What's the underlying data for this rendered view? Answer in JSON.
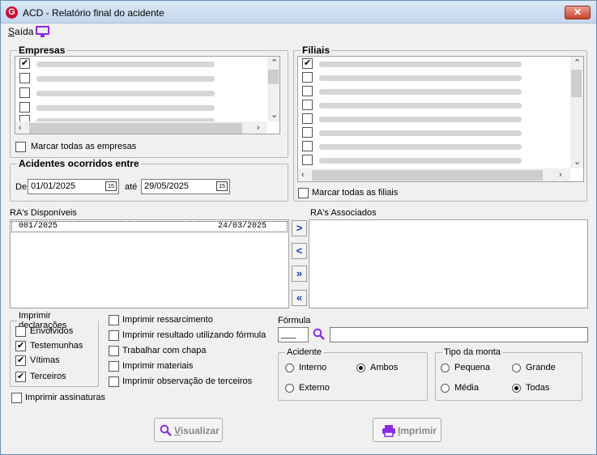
{
  "window": {
    "title": "ACD - Relatório final do acidente",
    "close": "✕",
    "app_icon_letter": "G"
  },
  "menu": {
    "saida_first": "S",
    "saida_rest": "aída"
  },
  "empresas": {
    "title": "Empresas",
    "rows": [
      {
        "checked": true
      },
      {
        "checked": false
      },
      {
        "checked": false
      },
      {
        "checked": false
      },
      {
        "checked": false
      }
    ],
    "mark_all_label": "Marcar todas as empresas"
  },
  "filiais": {
    "title": "Filiais",
    "rows": [
      {
        "checked": true
      },
      {
        "checked": false
      },
      {
        "checked": false
      },
      {
        "checked": false
      },
      {
        "checked": false
      },
      {
        "checked": false
      },
      {
        "checked": false
      },
      {
        "checked": false
      }
    ],
    "mark_all_label": "Marcar todas as filiais"
  },
  "acidentes": {
    "title": "Acidentes ocorridos entre",
    "de_label": "De",
    "de_value": "01/01/2025",
    "ate_label": "até",
    "ate_value": "29/05/2025",
    "cal_icon_text": "15"
  },
  "ra": {
    "disponiveis_label": "RA's Disponíveis",
    "associados_label": "RA's Associados",
    "rows": [
      {
        "numero": "001/2025",
        "data": "24/03/2025"
      }
    ],
    "buttons": {
      "add": ">",
      "remove": "<",
      "add_all": "»",
      "remove_all": "«"
    }
  },
  "declaracoes": {
    "title": "Imprimir declarações",
    "items": [
      {
        "label": "Envolvidos",
        "checked": false
      },
      {
        "label": "Testemunhas",
        "checked": true
      },
      {
        "label": "Vítimas",
        "checked": true
      },
      {
        "label": "Terceiros",
        "checked": true
      }
    ]
  },
  "imprimir_assinaturas": {
    "label": "Imprimir assinaturas",
    "checked": false
  },
  "options": [
    {
      "label": "Imprimir ressarcimento",
      "checked": false
    },
    {
      "label": "Imprimir resultado utilizando fórmula",
      "checked": false
    },
    {
      "label": "Trabalhar com chapa",
      "checked": false
    },
    {
      "label": "Imprimir materiais",
      "checked": false
    },
    {
      "label": "Imprimir observação de terceiros",
      "checked": false
    }
  ],
  "formula": {
    "label": "Fórmula",
    "code_value": "___",
    "desc_value": ""
  },
  "acidente": {
    "title": "Acidente",
    "options": [
      {
        "label": "Interno",
        "selected": false
      },
      {
        "label": "Ambos",
        "selected": true
      },
      {
        "label": "Externo",
        "selected": false
      }
    ]
  },
  "tipo_monta": {
    "title": "Tipo da monta",
    "options": [
      {
        "label": "Pequena",
        "selected": false
      },
      {
        "label": "Grande",
        "selected": false
      },
      {
        "label": "Média",
        "selected": false
      },
      {
        "label": "Todas",
        "selected": true
      }
    ]
  },
  "buttons": {
    "visualizar_first": "V",
    "visualizar_rest": "isualizar",
    "imprimir_first": "I",
    "imprimir_rest": "mprimir"
  },
  "colors": {
    "accent": "#8a2be2",
    "arrow_blue": "#1a3fb0",
    "title_bar": "#c4d7ee",
    "close_red": "#c6442c"
  }
}
